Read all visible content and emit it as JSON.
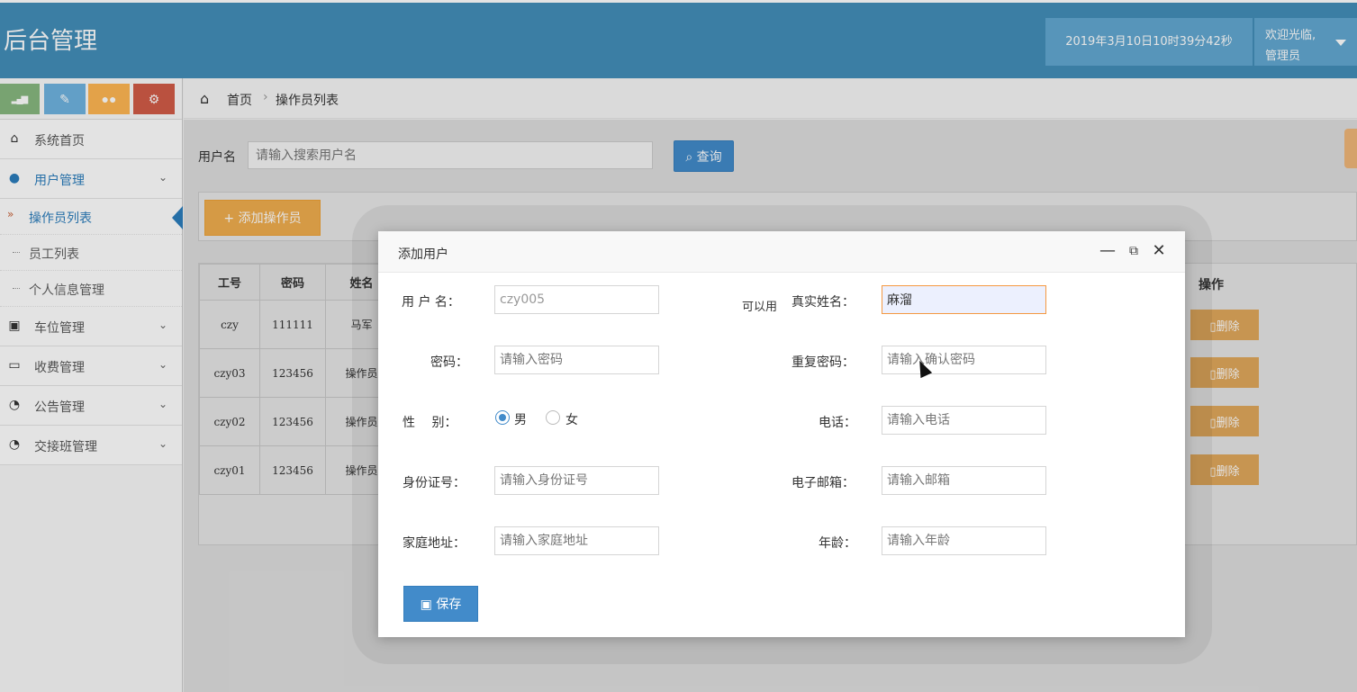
{
  "header": {
    "brand": "后台管理",
    "datetime": "2019年3月10日10时39分42秒",
    "welcome": "欢迎光临,",
    "role": "管理员"
  },
  "shortcuts": [
    {
      "icon": "signal-icon",
      "color": "#87b87f",
      "glyph": "▂▄▆"
    },
    {
      "icon": "pencil-icon",
      "color": "#6fb3e0",
      "glyph": "✎"
    },
    {
      "icon": "users-icon",
      "color": "#ffb752",
      "glyph": "👥"
    },
    {
      "icon": "cogs-icon",
      "color": "#d15b47",
      "glyph": "⚙"
    }
  ],
  "sidebar": {
    "home": "系统首页",
    "user_mgmt": "用户管理",
    "sub": [
      "操作员列表",
      "员工列表",
      "个人信息管理"
    ],
    "parking": "车位管理",
    "billing": "收费管理",
    "notice": "公告管理",
    "shift": "交接班管理"
  },
  "breadcrumb": {
    "home": "首页",
    "current": "操作员列表",
    "sep": "›"
  },
  "search": {
    "label": "用户名",
    "placeholder": "请输入搜索用户名",
    "button": "查询"
  },
  "toolbar": {
    "add": "添加操作员"
  },
  "table": {
    "headers": [
      "工号",
      "密码",
      "姓名"
    ],
    "ops_header": "操作",
    "rows": [
      [
        "czy",
        "111111",
        "马军"
      ],
      [
        "czy03",
        "123456",
        "操作员"
      ],
      [
        "czy02",
        "123456",
        "操作员"
      ],
      [
        "czy01",
        "123456",
        "操作员"
      ]
    ],
    "delete": "删除"
  },
  "modal": {
    "title": "添加用户",
    "username_label": "用 户 名：",
    "username_value": "czy005",
    "hint": "可以用",
    "realname_label": "真实姓名：",
    "realname_value": "麻溜",
    "password_label": "密码：",
    "password_ph": "请输入密码",
    "repeat_label": "重复密码：",
    "repeat_ph": "请输入确认密码",
    "gender_label": "性　 别：",
    "male": "男",
    "female": "女",
    "phone_label": "电话：",
    "phone_ph": "请输入电话",
    "idcard_label": "身份证号：",
    "idcard_ph": "请输入身份证号",
    "email_label": "电子邮箱：",
    "email_ph": "请输入邮箱",
    "address_label": "家庭地址：",
    "address_ph": "请输入家庭地址",
    "age_label": "年龄：",
    "age_ph": "请输入年龄",
    "save": "保存"
  }
}
